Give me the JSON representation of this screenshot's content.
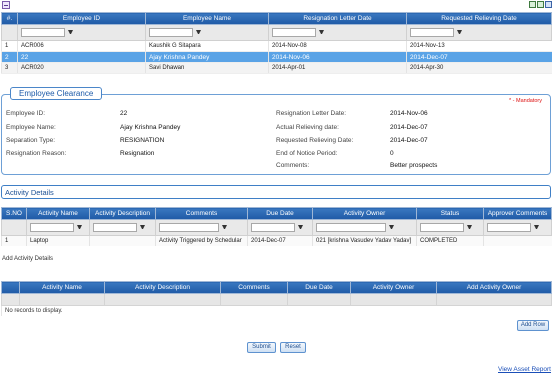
{
  "employees": {
    "columns": [
      "#.",
      "Employee ID",
      "Employee Name",
      "Resignation Letter Date",
      "Requested Relieving Date"
    ],
    "rows": [
      {
        "num": "1",
        "id": "ACR006",
        "name": "Kaushik G Sitapara",
        "letter_date": "2014-Nov-08",
        "relieving_date": "2014-Nov-13"
      },
      {
        "num": "2",
        "id": "22",
        "name": "Ajay Krishna Pandey",
        "letter_date": "2014-Nov-06",
        "relieving_date": "2014-Dec-07"
      },
      {
        "num": "3",
        "id": "ACR020",
        "name": "Savi Dhawan",
        "letter_date": "2014-Apr-01",
        "relieving_date": "2014-Apr-30"
      }
    ],
    "selected_index": 1
  },
  "clearance": {
    "title": "Employee Clearance",
    "mandatory_note": "* - Mandatory",
    "left": [
      {
        "label": "Employee ID:",
        "value": "22"
      },
      {
        "label": "Employee Name:",
        "value": "Ajay Krishna Pandey"
      },
      {
        "label": "Separation Type:",
        "value": "RESIGNATION"
      },
      {
        "label": "Resignation Reason:",
        "value": "Resignation"
      }
    ],
    "right": [
      {
        "label": "Resignation Letter Date:",
        "value": "2014-Nov-06"
      },
      {
        "label": "Actual Relieving date:",
        "value": "2014-Dec-07"
      },
      {
        "label": "Requested Relieving Date:",
        "value": "2014-Dec-07"
      },
      {
        "label": "End of Notice Period:",
        "value": "0"
      },
      {
        "label": "Comments:",
        "value": "Better prospects"
      }
    ]
  },
  "activity_details": {
    "title": "Activity Details",
    "columns": [
      "S.NO",
      "Activity Name",
      "Activity Description",
      "Comments",
      "Due Date",
      "Activity Owner",
      "Status",
      "Approver Comments"
    ],
    "rows": [
      {
        "sno": "1",
        "name": "Laptop",
        "description": "",
        "comments": "Activity Triggered by Schedular",
        "due": "2014-Dec-07",
        "owner": "021 [krishna Vasudev Yadav Yadav]",
        "status": "COMPLETED",
        "approver": ""
      }
    ]
  },
  "add_activity": {
    "link_label": "Add Activity Details",
    "columns": [
      "Activity Name",
      "Activity Description",
      "Comments",
      "Due Date",
      "Activity Owner",
      "Add Activity Owner"
    ],
    "empty_text": "No records to display.",
    "add_row_label": "Add Row"
  },
  "actions": {
    "submit": "Submit",
    "reset": "Reset",
    "report_link": "View Asset Report"
  }
}
